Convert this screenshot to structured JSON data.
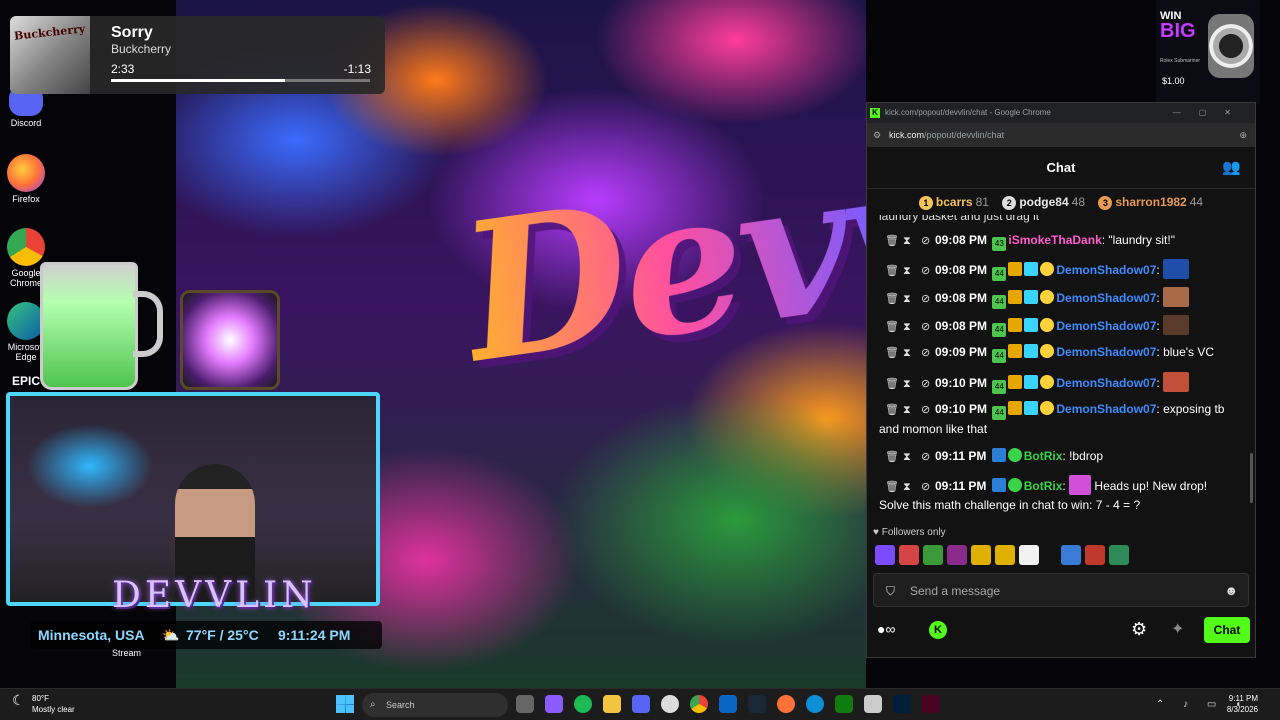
{
  "media": {
    "title": "Sorry",
    "artist": "Buckcherry",
    "album_art_text": "Buckcherry",
    "elapsed": "2:33",
    "remaining": "-1:13",
    "progress": 0.67
  },
  "desktop_icons": [
    "Discord",
    "Firefox",
    "Google Chrome",
    "Microsoft Edge",
    "EPIC"
  ],
  "stream": {
    "title": "Devvli",
    "channel_logo": "DEVVLIN",
    "location": "Minnesota, USA",
    "temperature": "77°F / 25°C",
    "time": "9:11:24 PM",
    "stream_label": "Stream"
  },
  "ad": {
    "headline_line1": "WIN",
    "headline_line2": "BIG",
    "subtext": "Rolex Submariner",
    "price": "$1.00"
  },
  "chrome": {
    "window_title": "kick.com/popout/devvlin/chat - Google Chrome",
    "url_domain": "kick.com",
    "url_path": "/popout/devvlin/chat"
  },
  "chat": {
    "header": "Chat",
    "leaderboard": [
      {
        "rank": "1",
        "name": "bcarrs",
        "count": "81"
      },
      {
        "rank": "2",
        "name": "podge84",
        "count": "48"
      },
      {
        "rank": "3",
        "name": "sharron1982",
        "count": "44"
      }
    ],
    "cut_text": "laundry basket and just drag it",
    "messages": [
      {
        "time": "09:08 PM",
        "sub_badge": "43",
        "user": "iSmokeThaDank",
        "user_color": "#ff5ccd",
        "text": "\"laundry sit!\"",
        "badges": [
          "sub"
        ]
      },
      {
        "time": "09:08 PM",
        "sub_badge": "44",
        "user": "DemonShadow07",
        "user_color": "#3d8bff",
        "text": "",
        "badges": [
          "sub",
          "crown",
          "gift",
          "star"
        ],
        "emote": "#1d4fa8"
      },
      {
        "time": "09:08 PM",
        "sub_badge": "44",
        "user": "DemonShadow07",
        "user_color": "#3d8bff",
        "text": "",
        "badges": [
          "sub",
          "crown",
          "gift",
          "star"
        ],
        "emote": "#a96a4a"
      },
      {
        "time": "09:08 PM",
        "sub_badge": "44",
        "user": "DemonShadow07",
        "user_color": "#3d8bff",
        "text": "",
        "badges": [
          "sub",
          "crown",
          "gift",
          "star"
        ],
        "emote": "#5a3a2a"
      },
      {
        "time": "09:09 PM",
        "sub_badge": "44",
        "user": "DemonShadow07",
        "user_color": "#3d8bff",
        "text": "blue's VC",
        "badges": [
          "sub",
          "crown",
          "gift",
          "star"
        ]
      },
      {
        "time": "09:10 PM",
        "sub_badge": "44",
        "user": "DemonShadow07",
        "user_color": "#3d8bff",
        "text": "",
        "badges": [
          "sub",
          "crown",
          "gift",
          "star"
        ],
        "emote": "#c0503a"
      },
      {
        "time": "09:10 PM",
        "sub_badge": "44",
        "user": "DemonShadow07",
        "user_color": "#3d8bff",
        "text": "exposing tb",
        "continuation": "and momon like that",
        "badges": [
          "sub",
          "crown",
          "gift",
          "star"
        ]
      },
      {
        "time": "09:11 PM",
        "user": "BotRix",
        "user_color": "#3bd34a",
        "text": "!bdrop",
        "badges": [
          "bot",
          "verified"
        ]
      },
      {
        "time": "09:11 PM",
        "user": "BotRix",
        "user_color": "#3bd34a",
        "text": "Heads up! New drop!",
        "continuation": "Solve this math challenge in chat to win: 7 - 4 = ?",
        "badges": [
          "bot",
          "verified"
        ],
        "emote": "#d24fd8"
      }
    ],
    "followers_only": "Followers only",
    "input_placeholder": "Send a message",
    "send_label": "Chat",
    "emote_colors": [
      "#7b4cff",
      "#d64545",
      "#3a9a3a",
      "#8a2a8a",
      "#e0b000",
      "#e0b000",
      "#f2f2f2",
      "#3a7bd5",
      "#c0392b",
      "#2e8b57"
    ]
  },
  "taskbar": {
    "weather_temp": "80°F",
    "weather_desc": "Mostly clear",
    "search_placeholder": "Search",
    "clock_time": "9:11 PM",
    "clock_date": "8/3/2026"
  },
  "colors": {
    "kick_green": "#53fc18",
    "chat_bg": "#121212"
  }
}
